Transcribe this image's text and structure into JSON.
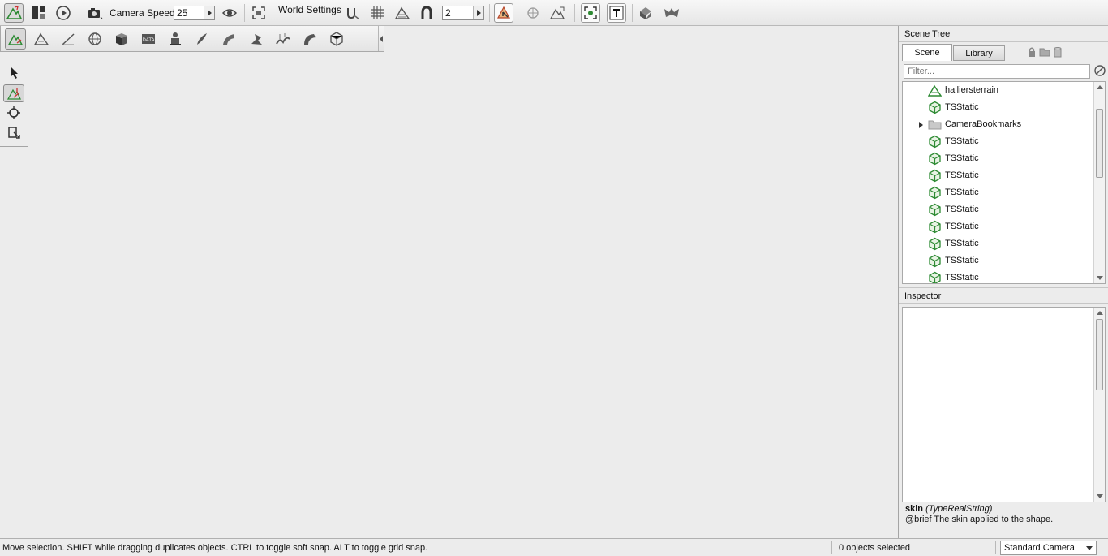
{
  "colors": {
    "sky_top": "#8ec1f0",
    "sky_horizon": "#c6e2f6",
    "grass": "#6e9244",
    "road": "#a7a29a",
    "road_line": "#e09a3a",
    "horizon_artifact": "#ff00ff",
    "terrain_icon_green": "#2d8a33"
  },
  "toolbar": {
    "camera_speed_label": "Camera Speed",
    "camera_speed_value": "25",
    "world_settings_label": "World Settings",
    "snap_value": "2",
    "icons": [
      "world-editor-icon",
      "gui-editor-icon",
      "play-game-icon",
      "camera-icon",
      "visibility-eye-icon",
      "fit-selection-icon",
      "snap-to-terrain-icon",
      "grid-snap-icon",
      "terrain-snap-icon",
      "magnet-icon",
      "object-select-icon",
      "bounds-center-icon",
      "align-to-terrain-icon",
      "selection-box-icon",
      "text-labels-icon",
      "mesh-road-icon",
      "river-icon"
    ]
  },
  "palette": {
    "icons": [
      "terrain-editor-icon",
      "terrain-painter-icon",
      "sketch-tool-icon",
      "globe-icon",
      "cube-icon",
      "data-block-icon",
      "robot-icon",
      "forest-icon",
      "road-icon",
      "river-tool-icon",
      "mesh-road-tool-icon",
      "bend-tool-icon",
      "shape-icon"
    ]
  },
  "tools": {
    "icons": [
      "select-arrow-icon",
      "move-gizmo-icon",
      "rotate-gizmo-icon",
      "scale-gizmo-icon"
    ]
  },
  "viewport": {
    "object_label": "halliersterrain"
  },
  "scene_tree": {
    "title": "Scene Tree",
    "tab_scene": "Scene",
    "tab_library": "Library",
    "filter_placeholder": "Filter...",
    "items": [
      {
        "name": "halliersterrain",
        "icon": "terrain-icon",
        "expandable": false
      },
      {
        "name": "TSStatic",
        "icon": "tsstatic-icon",
        "expandable": false
      },
      {
        "name": "CameraBookmarks",
        "icon": "folder-icon",
        "expandable": true
      },
      {
        "name": "TSStatic",
        "icon": "tsstatic-icon",
        "expandable": false
      },
      {
        "name": "TSStatic",
        "icon": "tsstatic-icon",
        "expandable": false
      },
      {
        "name": "TSStatic",
        "icon": "tsstatic-icon",
        "expandable": false
      },
      {
        "name": "TSStatic",
        "icon": "tsstatic-icon",
        "expandable": false
      },
      {
        "name": "TSStatic",
        "icon": "tsstatic-icon",
        "expandable": false
      },
      {
        "name": "TSStatic",
        "icon": "tsstatic-icon",
        "expandable": false
      },
      {
        "name": "TSStatic",
        "icon": "tsstatic-icon",
        "expandable": false
      },
      {
        "name": "TSStatic",
        "icon": "tsstatic-icon",
        "expandable": false
      },
      {
        "name": "TSStatic",
        "icon": "tsstatic-icon",
        "expandable": false
      }
    ]
  },
  "inspector": {
    "title": "Inspector",
    "field_name": "skin",
    "field_type": "(TypeRealString)",
    "field_doc": "@brief The skin applied to the shape."
  },
  "status": {
    "message": "Move selection.  SHIFT while dragging duplicates objects.  CTRL to toggle soft snap.  ALT to toggle grid snap.",
    "selection": "0 objects selected",
    "camera_mode": "Standard Camera"
  }
}
